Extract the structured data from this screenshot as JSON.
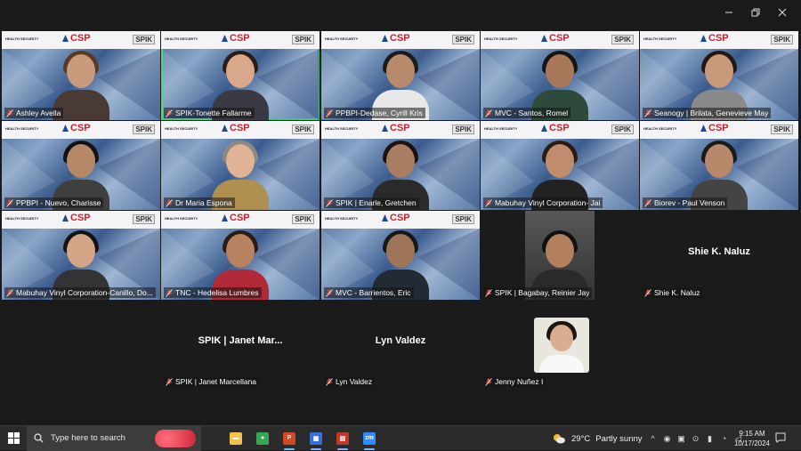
{
  "window": {
    "controls": [
      {
        "name": "minimize-button",
        "icon": "minimize-icon"
      },
      {
        "name": "restore-button",
        "icon": "restore-icon"
      },
      {
        "name": "close-button",
        "icon": "close-icon"
      }
    ]
  },
  "banner": {
    "left": "HEALTH SECURITY",
    "center": "CSP",
    "right": "SPIK"
  },
  "participants": [
    {
      "label": "Ashley Avella",
      "muted": true,
      "video": true
    },
    {
      "label": "SPIK-Tonette Fallarme",
      "muted": false,
      "video": true,
      "active": true
    },
    {
      "label": "PPBPI-Dedase, Cyrill Kris",
      "muted": true,
      "video": true
    },
    {
      "label": "MVC - Santos, Romel",
      "muted": true,
      "video": true
    },
    {
      "label": "Seanogy | Brilata, Genevieve May",
      "muted": true,
      "video": true
    },
    {
      "label": "PPBPI - Nuevo, Charisse",
      "muted": true,
      "video": true
    },
    {
      "label": "Dr Maria Espona",
      "muted": true,
      "video": true
    },
    {
      "label": "SPIK | Enarle, Gretchen",
      "muted": true,
      "video": true
    },
    {
      "label": "Mabuhay Vinyl Corporation- Jai",
      "muted": true,
      "video": true
    },
    {
      "label": "Biorev - Paul Venson",
      "muted": true,
      "video": true
    },
    {
      "label": "Mabuhay Vinyl Corporation-Canillo, Do...",
      "muted": true,
      "video": true
    },
    {
      "label": "TNC - Hedelisa Lumbres",
      "muted": true,
      "video": true
    },
    {
      "label": "MVC - Barrientos, Eric",
      "muted": true,
      "video": true
    },
    {
      "label": "SPIK | Bagabay, Reinier Jay",
      "muted": true,
      "video": true
    },
    {
      "label": "Shie K. Naluz",
      "muted": true,
      "video": false,
      "display_name": "Shie K. Naluz"
    },
    {
      "label": "SPIK | Janet Marcellana",
      "muted": true,
      "video": false,
      "display_name": "SPIK | Janet Mar..."
    },
    {
      "label": "Lyn Valdez",
      "muted": true,
      "video": false,
      "display_name": "Lyn Valdez"
    },
    {
      "label": "Jenny Nuñez I",
      "muted": true,
      "video": false,
      "photo": true
    }
  ],
  "taskbar": {
    "search_placeholder": "Type here to search",
    "apps": [
      {
        "name": "file-explorer",
        "icon": "folder-icon",
        "color": "#f2c14e"
      },
      {
        "name": "chrome",
        "icon": "chrome-icon",
        "color": "#34a853"
      },
      {
        "name": "powerpoint",
        "icon": "powerpoint-icon",
        "color": "#d24726"
      },
      {
        "name": "app-4",
        "icon": "app-icon",
        "color": "#3b6fd8"
      },
      {
        "name": "calendar",
        "icon": "calendar-icon",
        "color": "#c0392b"
      },
      {
        "name": "zoom",
        "icon": "zoom-icon",
        "color": "#2d8cff"
      }
    ],
    "weather_temp": "29°C",
    "weather_desc": "Partly sunny",
    "time": "9:15 AM",
    "date": "10/17/2024"
  }
}
